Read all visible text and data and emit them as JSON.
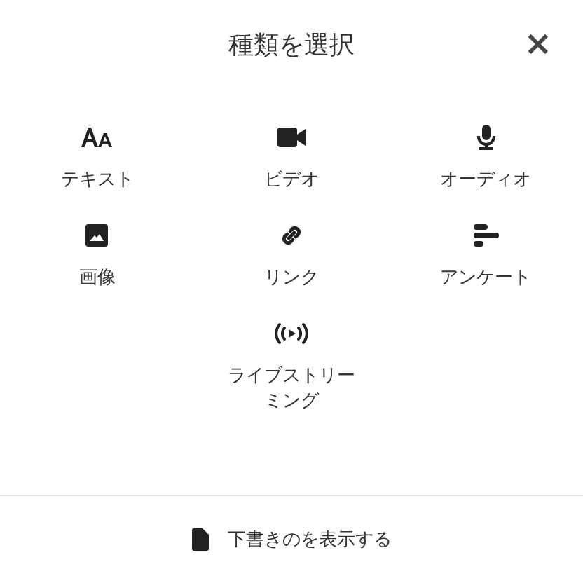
{
  "dialog": {
    "title": "種類を選択",
    "close": "×"
  },
  "options": [
    {
      "kind": "text",
      "label": "テキスト"
    },
    {
      "kind": "video",
      "label": "ビデオ"
    },
    {
      "kind": "audio",
      "label": "オーディオ"
    },
    {
      "kind": "image",
      "label": "画像"
    },
    {
      "kind": "link",
      "label": "リンク"
    },
    {
      "kind": "poll",
      "label": "アンケート"
    },
    {
      "kind": "live",
      "label": "ライブストリーミング"
    }
  ],
  "footer": {
    "label": "下書きのを表示する"
  }
}
